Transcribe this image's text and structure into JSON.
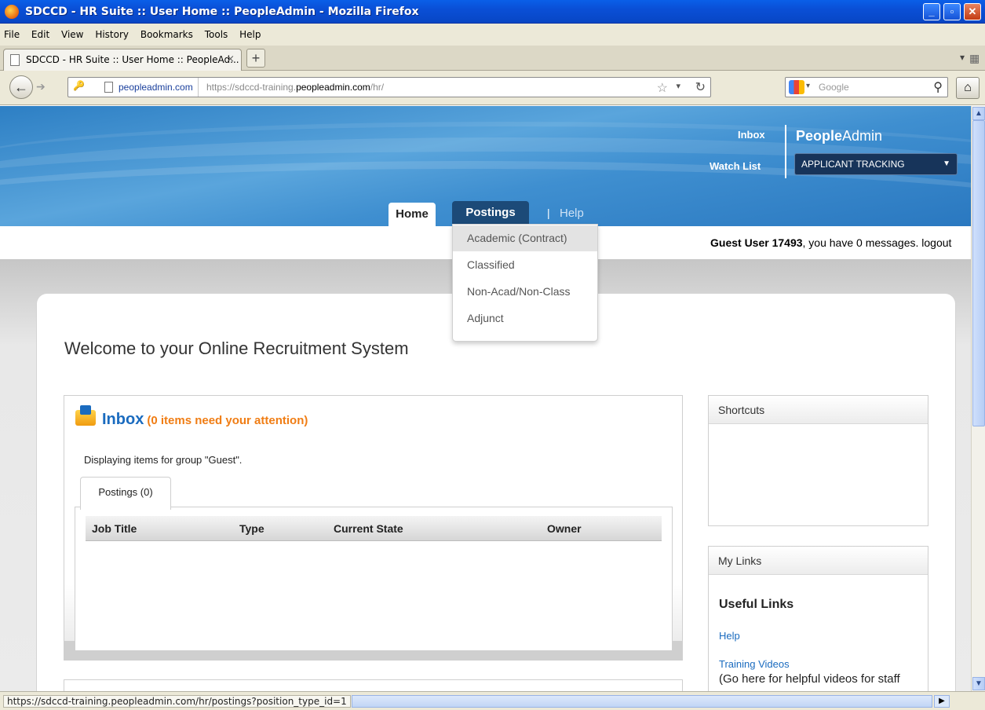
{
  "window": {
    "title": "SDCCD - HR Suite :: User Home :: PeopleAdmin - Mozilla Firefox",
    "btn_min": "_",
    "btn_max": "▫",
    "btn_close": "✕"
  },
  "menubar": [
    "File",
    "Edit",
    "View",
    "History",
    "Bookmarks",
    "Tools",
    "Help"
  ],
  "browser_tab": {
    "label": "SDCCD - HR Suite :: User Home :: PeopleAd...",
    "close": "×",
    "new_tab": "+"
  },
  "nav": {
    "back": "←",
    "forward": "➔",
    "site_identity": "peopleadmin.com",
    "url_prefix": "https://sdccd-training.",
    "url_domain": "peopleadmin.com",
    "url_suffix": "/hr/",
    "search_placeholder": "Google",
    "home": "⌂"
  },
  "banner": {
    "inbox_link": "Inbox",
    "watchlist_link": "Watch List",
    "logo_bold": "People",
    "logo_rest": "Admin",
    "module_select": "APPLICANT TRACKING",
    "tabs": {
      "home": "Home",
      "postings": "Postings",
      "separator": "|",
      "help": "Help"
    }
  },
  "greeting": {
    "user": "Guest User 17493",
    "rest": ", you have 0 messages. logout"
  },
  "postings_menu": [
    {
      "label": "Academic (Contract)",
      "active": true
    },
    {
      "label": "Classified",
      "active": false
    },
    {
      "label": "Non-Acad/Non-Class",
      "active": false
    },
    {
      "label": "Adjunct",
      "active": false
    }
  ],
  "main": {
    "welcome": "Welcome to your Online Recruitment System",
    "inbox": {
      "title": "Inbox",
      "attention": "(0 items need your attention)",
      "displaying": "Displaying items for group \"Guest\".",
      "tab": "Postings (0)",
      "columns": [
        "Job Title",
        "Type",
        "Current State",
        "Owner"
      ]
    }
  },
  "sidebar": {
    "shortcuts_title": "Shortcuts",
    "mylinks_title": "My Links",
    "useful_links": "Useful Links",
    "link_help": "Help",
    "link_training": "Training Videos",
    "training_desc": "(Go here for helpful videos for staff"
  },
  "status": {
    "url": "https://sdccd-training.peopleadmin.com/hr/postings?position_type_id=1"
  }
}
